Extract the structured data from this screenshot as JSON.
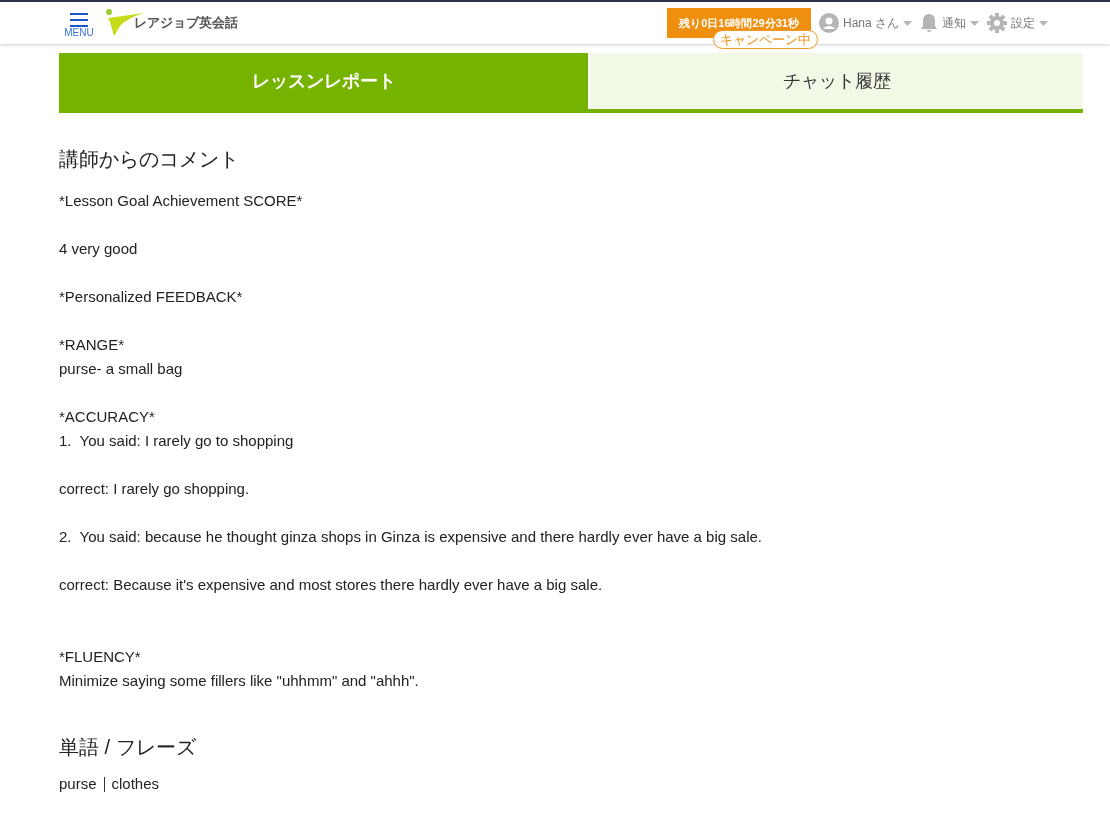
{
  "header": {
    "menu_label": "MENU",
    "logo_text": "レアジョブ英会話",
    "timer": "残り0日16時間29分31秒",
    "campaign_badge": "キャンペーン中",
    "user": "Hana さん",
    "notifications": "通知",
    "settings": "設定"
  },
  "tabs": [
    {
      "label": "レッスンレポート",
      "selected": true
    },
    {
      "label": "チャット履歴",
      "selected": false
    }
  ],
  "comment": {
    "heading": "講師からのコメント",
    "body": "*Lesson Goal Achievement SCORE*\n\n4 very good\n\n*Personalized FEEDBACK*\n\n*RANGE*\npurse- a small bag\n\n*ACCURACY*\n1.  You said: I rarely go to shopping\n\ncorrect: I rarely go shopping.\n\n2.  You said: because he thought ginza shops in Ginza is expensive and there hardly ever have a big sale.\n\ncorrect: Because it's expensive and most stores there hardly ever have a big sale.\n\n\n*FLUENCY*\nMinimize saying some fillers like \"uhhmm\" and \"ahhh\"."
  },
  "vocabulary": {
    "heading": "単語 / フレーズ",
    "words": [
      "purse",
      "clothes"
    ]
  }
}
